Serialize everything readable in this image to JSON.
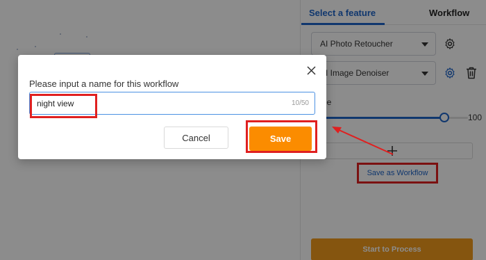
{
  "right_panel": {
    "tabs": [
      {
        "label": "Select a feature",
        "active": true
      },
      {
        "label": "Workflow",
        "active": false
      }
    ],
    "features": [
      {
        "label": "AI Photo Retoucher"
      },
      {
        "label": "AI Image Denoiser"
      }
    ],
    "degree_label": "ree",
    "slider": {
      "value": 100,
      "fraction": 0.85,
      "value_text": "100"
    },
    "add_icon": "plus-icon",
    "save_as_workflow_label": "Save as Workflow",
    "start_label": "Start to Process"
  },
  "dialog": {
    "title": "Please input a name for this workflow",
    "input_value": "night view",
    "char_count": "10/50",
    "cancel_label": "Cancel",
    "save_label": "Save"
  },
  "colors": {
    "accent": "#1e64c8",
    "save_orange": "#fb8c00",
    "annotation_red": "#e02020"
  }
}
